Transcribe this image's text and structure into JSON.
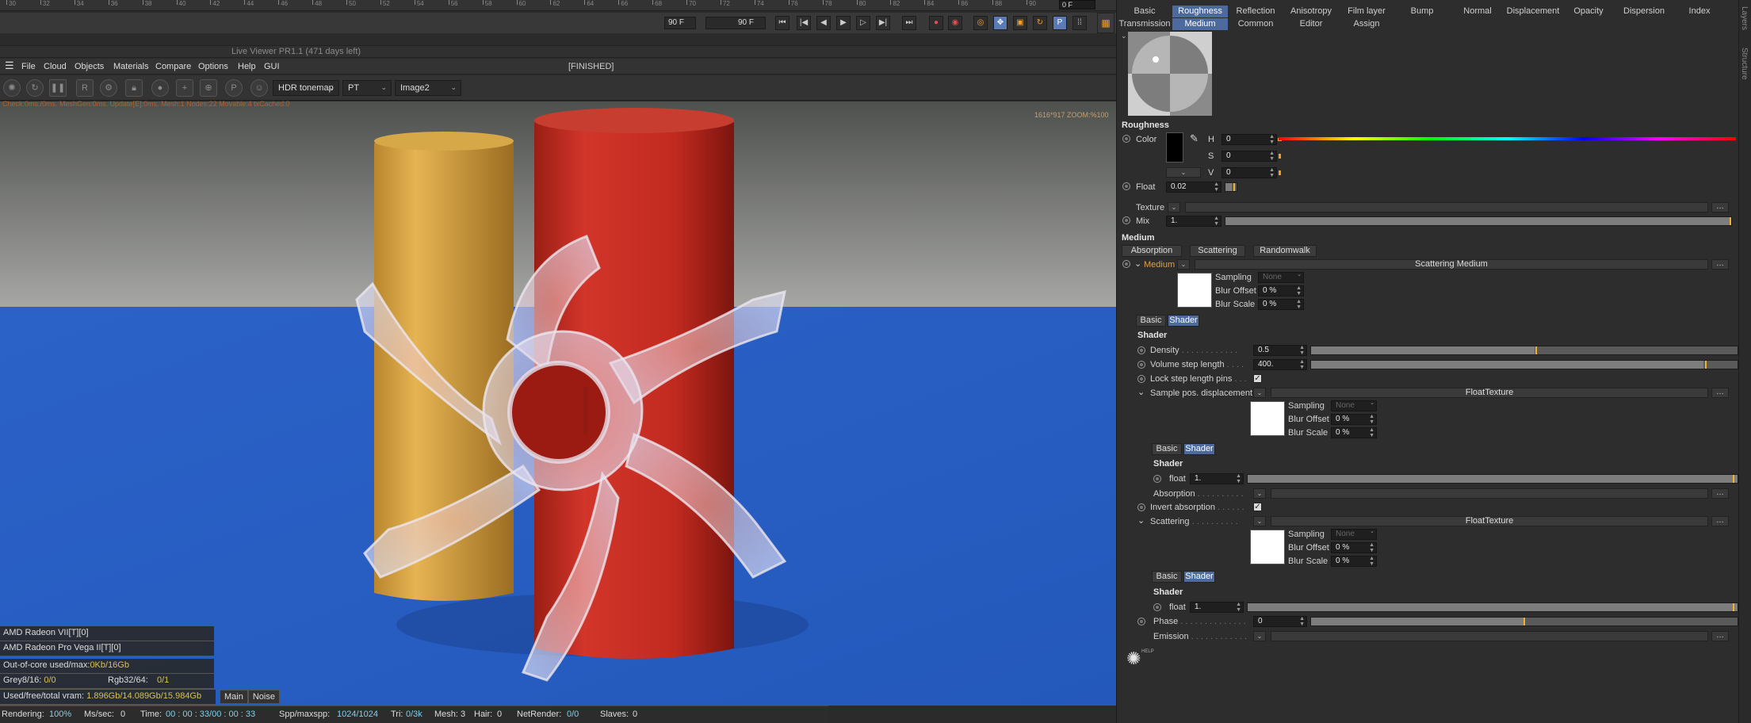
{
  "timeline": {
    "ticks": [
      "30",
      "32",
      "34",
      "36",
      "38",
      "40",
      "42",
      "44",
      "46",
      "48",
      "50",
      "52",
      "54",
      "56",
      "58",
      "60",
      "62",
      "64",
      "66",
      "68",
      "70",
      "72",
      "74",
      "76",
      "78",
      "80",
      "82",
      "84",
      "86",
      "88",
      "90"
    ],
    "current_frame": "0 F"
  },
  "frame_controls": {
    "start_frame": "90 F",
    "end_frame": "90 F"
  },
  "live_viewer": {
    "title": "Live Viewer PR1.1 (471 days left)",
    "status": "[FINISHED]"
  },
  "menu": [
    "File",
    "Cloud",
    "Objects",
    "Materials",
    "Compare",
    "Options",
    "Help",
    "GUI"
  ],
  "toolbar": {
    "tonemap": "HDR tonemap",
    "kernel": "PT",
    "image": "Image2"
  },
  "viewport": {
    "overlay_text": "Check:0ms./0ms. MeshGen:0ms. Update[E]:0ms. Mesh:1 Nodes:22 Movable:4 txCached:0",
    "zoom_text": "1616*917 ZOOM:%100"
  },
  "devices": [
    {
      "name": "AMD Radeon VII[T][0]"
    },
    {
      "name": "AMD Radeon Pro Vega II[T][0]"
    }
  ],
  "stats": {
    "out_of_core_label": "Out-of-core used/max:",
    "out_of_core_value": "0Kb/16Gb",
    "grey_label": "Grey8/16:",
    "grey_value": "0/0",
    "rgb_label": "Rgb32/64:",
    "rgb_value": "0/1",
    "vram_label": "Used/free/total vram:",
    "vram_value": "1.896Gb/14.089Gb/15.984Gb"
  },
  "mode_tabs": [
    "Main",
    "Noise"
  ],
  "bottom_bar": {
    "rendering_label": "Rendering:",
    "rendering_value": "100%",
    "mssec_label": "Ms/sec:",
    "mssec_value": "0",
    "time_label": "Time:",
    "time_value": "00 : 00 : 33/00 : 00 : 33",
    "spp_label": "Spp/maxspp:",
    "spp_value": "1024/1024",
    "tri_label": "Tri:",
    "tri_value": "0/3k",
    "mesh_label": "Mesh:",
    "mesh_value": "3",
    "hair_label": "Hair:",
    "hair_value": "0",
    "netrender_label": "NetRender:",
    "netrender_value": "0/0",
    "slaves_label": "Slaves:",
    "slaves_value": "0"
  },
  "material_tabs_row1": [
    "Basic",
    "Roughness",
    "Reflection",
    "Anisotropy",
    "Film layer",
    "Bump",
    "Normal",
    "Displacement",
    "Opacity",
    "Dispersion",
    "Index"
  ],
  "material_tabs_row2": [
    "Transmission",
    "Medium",
    "Common",
    "Editor",
    "Assign"
  ],
  "side_strip": {
    "layers": "Layers",
    "structure": "Structure"
  },
  "roughness": {
    "title": "Roughness",
    "color_label": "Color",
    "h_label": "H",
    "h_value": "0",
    "s_label": "S",
    "s_value": "0",
    "v_label": "V",
    "v_value": "0",
    "float_label": "Float",
    "float_value": "0.02",
    "float_fraction": 0.02,
    "texture_label": "Texture",
    "mix_label": "Mix",
    "mix_value": "1.",
    "mix_fraction": 1.0
  },
  "medium": {
    "title": "Medium",
    "subtabs": [
      "Absorption",
      "Scattering",
      "Randomwalk"
    ],
    "medium_label": "Medium",
    "medium_shader": "Scattering Medium",
    "sampling_label": "Sampling",
    "sampling_value": "None",
    "blur_offset_label": "Blur Offset",
    "blur_offset_value": "0 %",
    "blur_scale_label": "Blur Scale",
    "blur_scale_value": "0 %",
    "basic_label": "Basic",
    "shader_label": "Shader",
    "shader_title": "Shader",
    "density_label": "Density",
    "density_value": "0.5",
    "density_fraction": 0.5,
    "step_label": "Volume step length",
    "step_value": "400.",
    "step_fraction": 0.92,
    "lock_label": "Lock step length pins",
    "spd_label": "Sample pos. displacement",
    "spd_shader": "FloatTexture",
    "spd_sampling_value": "None",
    "spd_blur_offset_value": "0 %",
    "spd_blur_scale_value": "0 %",
    "spd_float_label": "float",
    "spd_float_value": "1.",
    "spd_float_fraction": 1.0,
    "absorption_label": "Absorption",
    "invert_label": "Invert absorption",
    "scattering_label": "Scattering",
    "scattering_shader": "FloatTexture",
    "sc_sampling_value": "None",
    "sc_blur_offset_value": "0 %",
    "sc_blur_scale_value": "0 %",
    "sc_float_label": "float",
    "sc_float_value": "1.",
    "sc_float_fraction": 1.0,
    "phase_label": "Phase",
    "phase_value": "0",
    "phase_fraction": 0.5,
    "emission_label": "Emission",
    "help_label": "HELP"
  }
}
